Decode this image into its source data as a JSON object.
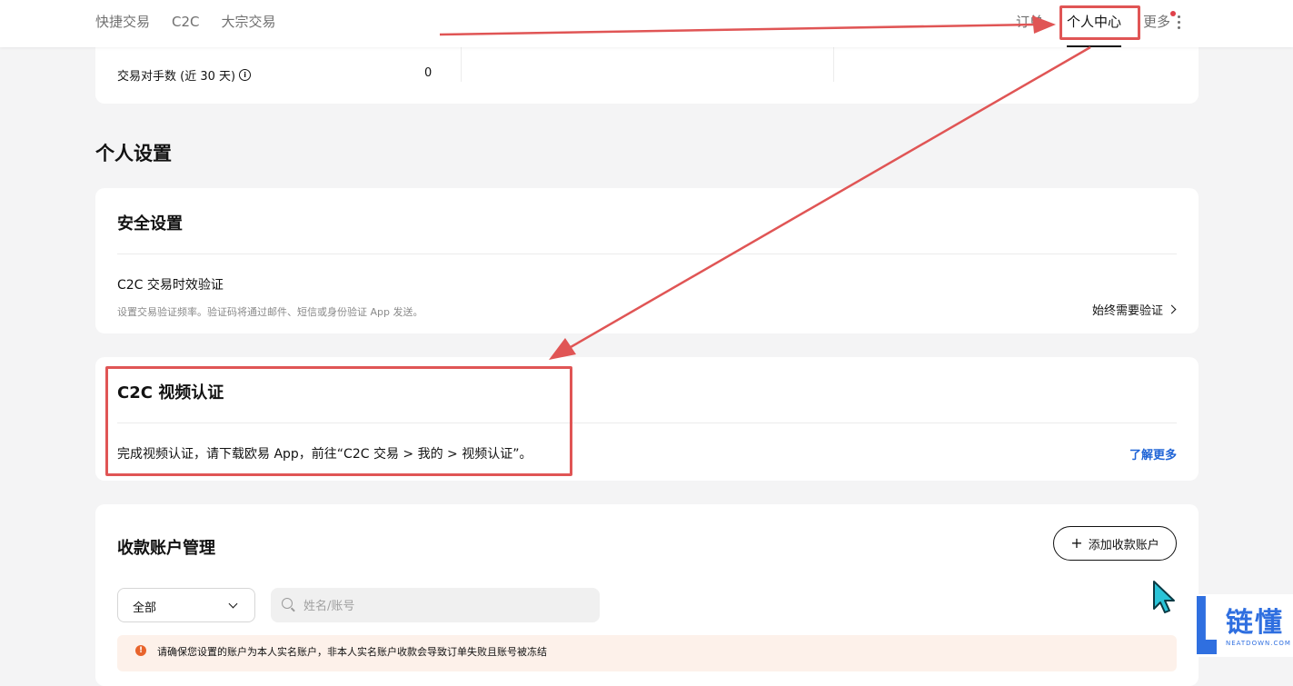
{
  "nav": {
    "left_items": [
      "快捷交易",
      "C2C",
      "大宗交易"
    ],
    "orders_label": "订单",
    "personal_label": "个人中心",
    "more_label": "更多"
  },
  "stats": {
    "label": "交易对手数 (近 30 天)",
    "value": "0"
  },
  "personal_settings": {
    "title": "个人设置"
  },
  "security": {
    "title": "安全设置",
    "row_title": "C2C 交易时效验证",
    "row_desc": "设置交易验证频率。验证码将通过邮件、短信或身份验证 App 发送。",
    "row_action": "始终需要验证"
  },
  "video_auth": {
    "title": "C2C 视频认证",
    "desc": "完成视频认证，请下载欧易 App，前往“C2C 交易 > 我的 > 视频认证”。",
    "learn_more": "了解更多"
  },
  "payment": {
    "title": "收款账户管理",
    "add_button": "添加收款账户",
    "filter_selected": "全部",
    "search_placeholder": "姓名/账号",
    "notice": "请确保您设置的账户为本人实名账户，非本人实名账户收款会导致订单失败且账号被冻结"
  },
  "watermark": {
    "text": "链懂",
    "subtext": "NEATDOWN.COM"
  },
  "colors": {
    "annotation_red": "#e05555",
    "link_blue": "#1e63d6",
    "notice_bg": "#fdf1ea",
    "warning_orange": "#e8642c",
    "cursor_cyan": "#29c4d8"
  }
}
